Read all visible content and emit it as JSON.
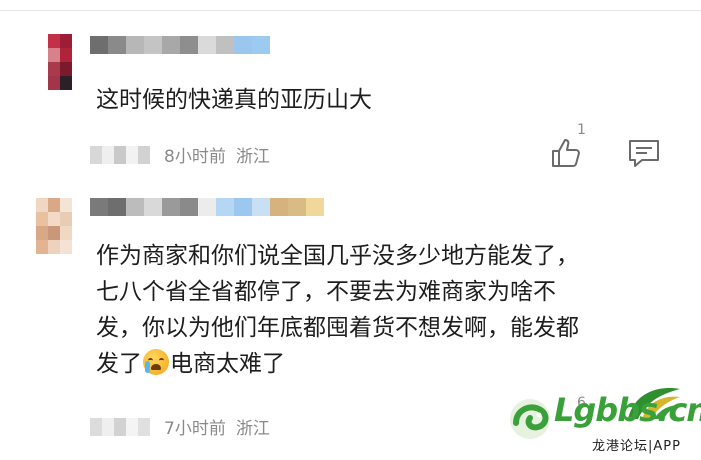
{
  "comments": [
    {
      "text": "这时候的快递真的亚历山大",
      "time": "8小时前",
      "location": "浙江",
      "likes": "1",
      "avatar_colors": [
        "#ffffff",
        "#c33048",
        "#9c1d35",
        "#ffffff",
        "#d8808c",
        "#b0243a",
        "#ffffff",
        "#a83a4c",
        "#7a1a2c",
        "#ffffff",
        "#a3354a",
        "#2b2028"
      ],
      "name_colors": [
        "#6e6e6e",
        "#8a8a8a",
        "#b7b7b7",
        "#c4c4c4",
        "#a8a8a8",
        "#8e8e8e",
        "#dadada",
        "#c0c0c0",
        "#9bc7ee",
        "#9dcaf0"
      ]
    },
    {
      "text": "作为商家和你们说全国几乎没多少地方能发了，\n七八个省全省都停了，不要去为难商家为啥不\n发，你以为他们年底都囤着货不想发啊，能发都\n发了",
      "text_after_emoji": "电商太难了",
      "time": "7小时前",
      "location": "浙江",
      "likes": "6",
      "avatar_colors": [
        "#efd7c4",
        "#d9a987",
        "#f3e4d6",
        "#e8c1a1",
        "#f2dac6",
        "#e8cdb4",
        "#d9a987",
        "#c9977a",
        "#f0d8c3",
        "#e3b491",
        "#eed2bb",
        "#f4e3d5"
      ],
      "name_colors": [
        "#7a7a7a",
        "#6e6e6e",
        "#bcbcbc",
        "#d9d9d9",
        "#9a9a9a",
        "#8a8a8a",
        "#ececec",
        "#b6d7f3",
        "#9cc8ef",
        "#c9dff3",
        "#d6b27c",
        "#d9bb84",
        "#f0d79a"
      ]
    }
  ],
  "watermark": {
    "site": "Lgbbs.cn",
    "subtitle": "龙港论坛|APP",
    "color": "#3aa13a"
  }
}
